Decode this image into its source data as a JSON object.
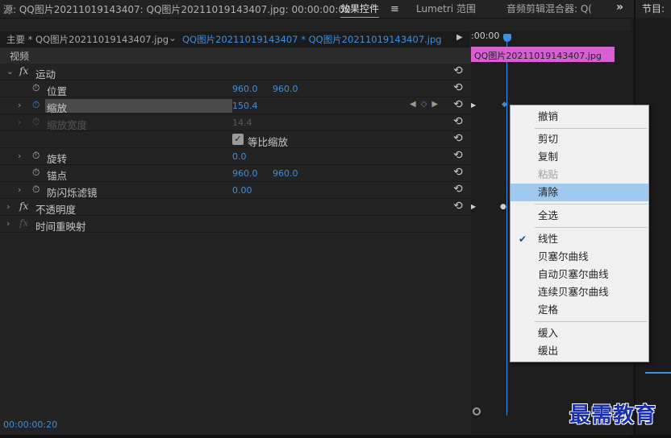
{
  "topbar": {
    "source_label": "源: QQ图片20211019143407: QQ图片20211019143407.jpg: 00:00:00:00",
    "tabs": [
      {
        "label": "效果控件",
        "active": true
      },
      {
        "label": "Lumetri 范围",
        "active": false
      },
      {
        "label": "音频剪辑混合器: Q(",
        "active": false
      }
    ],
    "menu_icon": "hamburger-menu-icon",
    "more_icon": "double-chevron-right-icon",
    "program_label": "节目:"
  },
  "clipbar": {
    "master_label": "主要 * QQ图片20211019143407.jpg",
    "clip_label": "QQ图片20211019143407 * QQ图片20211019143407.jpg"
  },
  "effects": {
    "video_header": "视频",
    "motion": {
      "label": "运动",
      "position": {
        "label": "位置",
        "x": "960.0",
        "y": "960.0"
      },
      "scale": {
        "label": "缩放",
        "value": "150.4"
      },
      "scale_width": {
        "label": "缩放宽度",
        "value": "14.4"
      },
      "uniform_scale": {
        "label": "等比缩放",
        "checked": true
      },
      "rotation": {
        "label": "旋转",
        "value": "0.0"
      },
      "anchor": {
        "label": "锚点",
        "x": "960.0",
        "y": "960.0"
      },
      "anti_flicker": {
        "label": "防闪烁滤镜",
        "value": "0.00"
      }
    },
    "opacity": {
      "label": "不透明度"
    },
    "time_remap": {
      "label": "时间重映射"
    }
  },
  "timecode_bottom": "00:00:00:20",
  "timeline": {
    "timecode": ":00:00",
    "clip_label": "QQ图片20211019143407.jpg"
  },
  "context_menu": {
    "items": [
      {
        "label": "撤销",
        "disabled": false
      },
      {
        "label": "剪切",
        "disabled": false
      },
      {
        "label": "复制",
        "disabled": false
      },
      {
        "label": "粘贴",
        "disabled": true
      },
      {
        "label": "清除",
        "disabled": false,
        "hover": true
      },
      {
        "label": "全选",
        "disabled": false
      },
      {
        "label": "线性",
        "disabled": false,
        "checked": true
      },
      {
        "label": "贝塞尔曲线",
        "disabled": false
      },
      {
        "label": "自动贝塞尔曲线",
        "disabled": false
      },
      {
        "label": "连续贝塞尔曲线",
        "disabled": false
      },
      {
        "label": "定格",
        "disabled": false
      },
      {
        "label": "缓入",
        "disabled": false
      },
      {
        "label": "缓出",
        "disabled": false
      }
    ]
  },
  "watermark": "最需教育",
  "colors": {
    "accent": "#3d8fe0",
    "clip": "#d75fd2",
    "menu_hover": "#9fc9ee"
  }
}
